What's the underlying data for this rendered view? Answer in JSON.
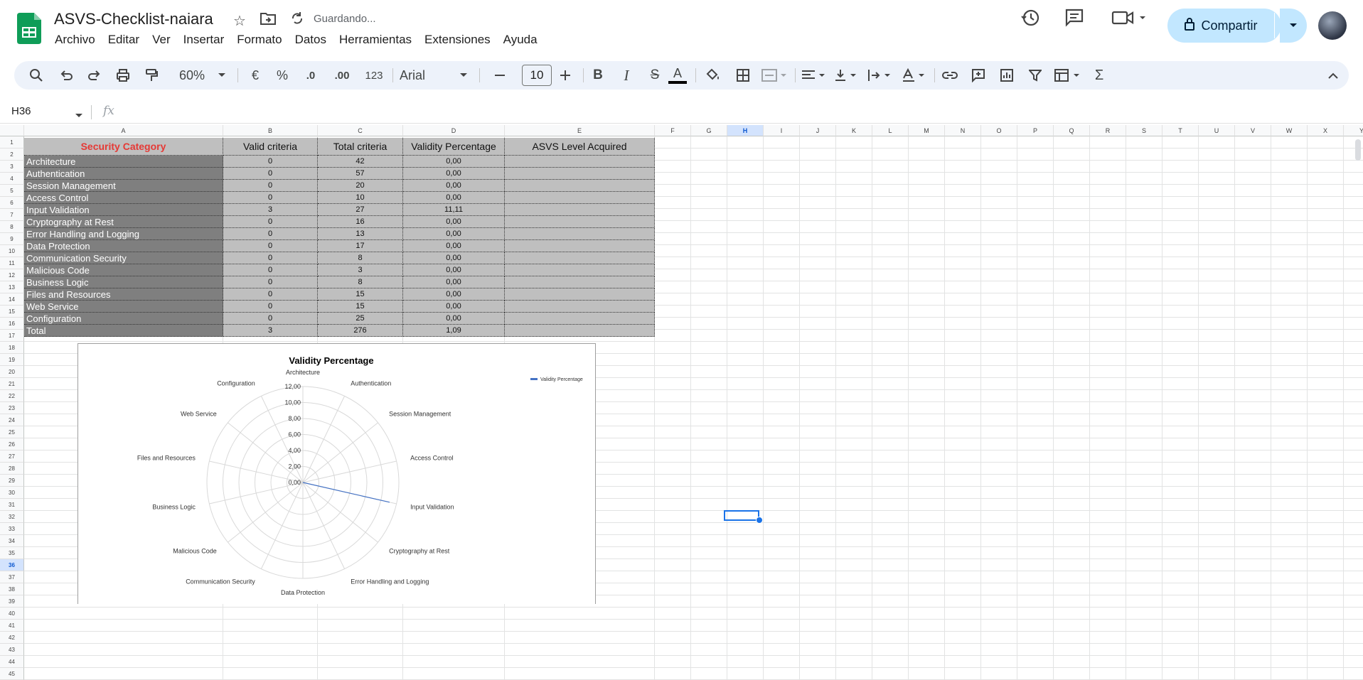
{
  "doc": {
    "title": "ASVS-Checklist-naiara",
    "status": "Guardando..."
  },
  "menu": [
    "Archivo",
    "Editar",
    "Ver",
    "Insertar",
    "Formato",
    "Datos",
    "Herramientas",
    "Extensiones",
    "Ayuda"
  ],
  "share": {
    "label": "Compartir"
  },
  "toolbar": {
    "zoom": "60%",
    "currency": "€",
    "percent": "%",
    "dec_less": ".0",
    "dec_more": ".00",
    "format_num": "123",
    "font": "Arial",
    "font_size": "10",
    "bold": "B",
    "italic": "I",
    "strike": "S",
    "text_color": "A",
    "sum": "Σ"
  },
  "formula_bar": {
    "cell_ref": "H36",
    "fx": "fx",
    "value": ""
  },
  "columns": [
    "A",
    "B",
    "C",
    "D",
    "E",
    "F",
    "G",
    "H",
    "I",
    "J",
    "K",
    "L",
    "M",
    "N",
    "O",
    "P",
    "Q",
    "R",
    "S",
    "T",
    "U",
    "V",
    "W",
    "X",
    "Y"
  ],
  "selected_col": "H",
  "selected_row": "36",
  "rows": [
    "1",
    "2",
    "3",
    "4",
    "5",
    "6",
    "7",
    "8",
    "9",
    "10",
    "11",
    "12",
    "13",
    "14",
    "15",
    "16",
    "17",
    "18",
    "19",
    "20",
    "21",
    "22",
    "23",
    "24",
    "25",
    "26",
    "27",
    "28",
    "29",
    "30",
    "31",
    "32",
    "33",
    "34",
    "35",
    "36",
    "37",
    "38",
    "39",
    "40",
    "41",
    "42",
    "43",
    "44",
    "45"
  ],
  "table": {
    "headers": [
      "Security Category",
      "Valid criteria",
      "Total criteria",
      "Validity Percentage",
      "ASVS Level Acquired"
    ],
    "rows": [
      [
        "Architecture",
        "0",
        "42",
        "0,00",
        ""
      ],
      [
        "Authentication",
        "0",
        "57",
        "0,00",
        ""
      ],
      [
        "Session Management",
        "0",
        "20",
        "0,00",
        ""
      ],
      [
        "Access Control",
        "0",
        "10",
        "0,00",
        ""
      ],
      [
        "Input Validation",
        "3",
        "27",
        "11,11",
        ""
      ],
      [
        "Cryptography at Rest",
        "0",
        "16",
        "0,00",
        ""
      ],
      [
        "Error Handling and Logging",
        "0",
        "13",
        "0,00",
        ""
      ],
      [
        "Data Protection",
        "0",
        "17",
        "0,00",
        ""
      ],
      [
        "Communication Security",
        "0",
        "8",
        "0,00",
        ""
      ],
      [
        "Malicious Code",
        "0",
        "3",
        "0,00",
        ""
      ],
      [
        "Business Logic",
        "0",
        "8",
        "0,00",
        ""
      ],
      [
        "Files and Resources",
        "0",
        "15",
        "0,00",
        ""
      ],
      [
        "Web Service",
        "0",
        "15",
        "0,00",
        ""
      ],
      [
        "Configuration",
        "0",
        "25",
        "0,00",
        ""
      ],
      [
        "Total",
        "3",
        "276",
        "1,09",
        ""
      ]
    ]
  },
  "chart_data": {
    "type": "radar",
    "title": "Validity Percentage",
    "categories": [
      "Architecture",
      "Authentication",
      "Session Management",
      "Access Control",
      "Input Validation",
      "Cryptography at Rest",
      "Error Handling and Logging",
      "Data Protection",
      "Communication Security",
      "Malicious Code",
      "Business Logic",
      "Files and Resources",
      "Web Service",
      "Configuration"
    ],
    "series": [
      {
        "name": "Validity Percentage",
        "values": [
          0,
          0,
          0,
          0,
          11.11,
          0,
          0,
          0,
          0,
          0,
          0,
          0,
          0,
          0
        ],
        "color": "#4472c4"
      }
    ],
    "ticks": [
      "0,00",
      "2,00",
      "4,00",
      "6,00",
      "8,00",
      "10,00",
      "12,00"
    ],
    "rlim": [
      0,
      12
    ],
    "legend": "top-right"
  },
  "colors": {
    "accent": "#1a73e8",
    "share_bg": "#c2e7ff",
    "cat_bg": "#7f7f7f",
    "cell_bg": "#bfbfbf",
    "header_red": "#e53935"
  }
}
